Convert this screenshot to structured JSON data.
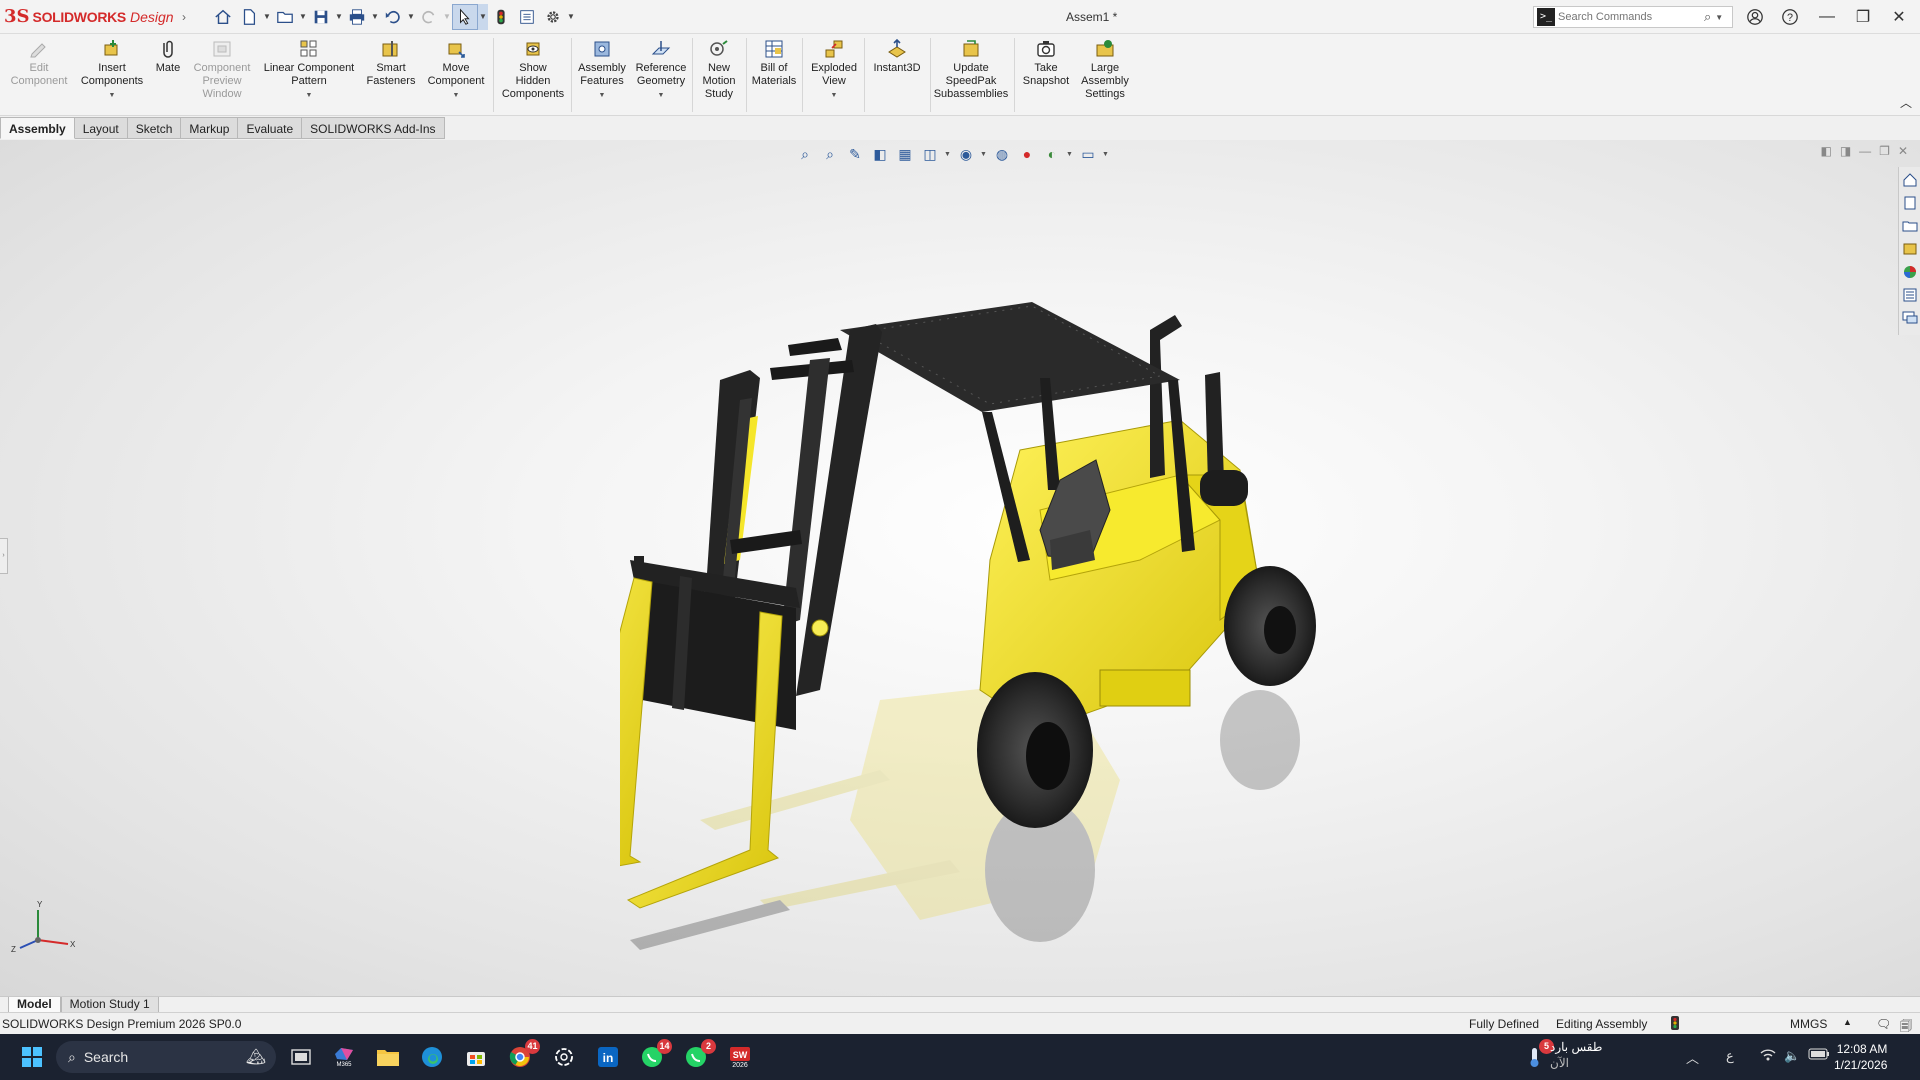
{
  "app": {
    "brand_ds": "3S",
    "brand_name": "SOLIDWORKS",
    "brand_suffix": "Design",
    "document_title": "Assem1 *"
  },
  "search": {
    "placeholder": "Search Commands"
  },
  "ribbon": {
    "edit_component": [
      "Edit",
      "Component"
    ],
    "insert_components": [
      "Insert",
      "Components"
    ],
    "mate": [
      "Mate"
    ],
    "component_preview": [
      "Component",
      "Preview",
      "Window"
    ],
    "linear_pattern": [
      "Linear Component",
      "Pattern"
    ],
    "smart_fasteners": [
      "Smart",
      "Fasteners"
    ],
    "move_component": [
      "Move",
      "Component"
    ],
    "show_hidden": [
      "Show",
      "Hidden",
      "Components"
    ],
    "assembly_features": [
      "Assembly",
      "Features"
    ],
    "reference_geometry": [
      "Reference",
      "Geometry"
    ],
    "new_motion_study": [
      "New",
      "Motion",
      "Study"
    ],
    "bill_of_materials": [
      "Bill of",
      "Materials"
    ],
    "exploded_view": [
      "Exploded",
      "View"
    ],
    "instant3d": [
      "Instant3D"
    ],
    "update_speedpak": [
      "Update",
      "SpeedPak",
      "Subassemblies"
    ],
    "take_snapshot": [
      "Take",
      "Snapshot"
    ],
    "large_assembly": [
      "Large",
      "Assembly",
      "Settings"
    ]
  },
  "tabs": [
    "Assembly",
    "Layout",
    "Sketch",
    "Markup",
    "Evaluate",
    "SOLIDWORKS Add-Ins"
  ],
  "triad": {
    "y": "Y",
    "x": "X",
    "z": "Z"
  },
  "bottom_tabs": [
    "Model",
    "Motion Study 1"
  ],
  "status": {
    "product": "SOLIDWORKS Design Premium 2026 SP0.0",
    "defined": "Fully Defined",
    "mode": "Editing Assembly",
    "units": "MMGS"
  },
  "taskbar": {
    "search": "Search",
    "weather_title": "طقس بارد",
    "weather_sub": "الآن",
    "weather_badge": "5",
    "lang": "ع",
    "time": "12:08 AM",
    "date": "1/21/2026",
    "chrome_badge": "41",
    "whatsapp_badge": "14",
    "whatsapp2_badge": "2",
    "sw_label": "2026",
    "m365_label": "M365"
  },
  "colors": {
    "accent": "#d42a2a",
    "forklift_yellow": "#f2e21a",
    "taskbar": "#1b2230"
  }
}
